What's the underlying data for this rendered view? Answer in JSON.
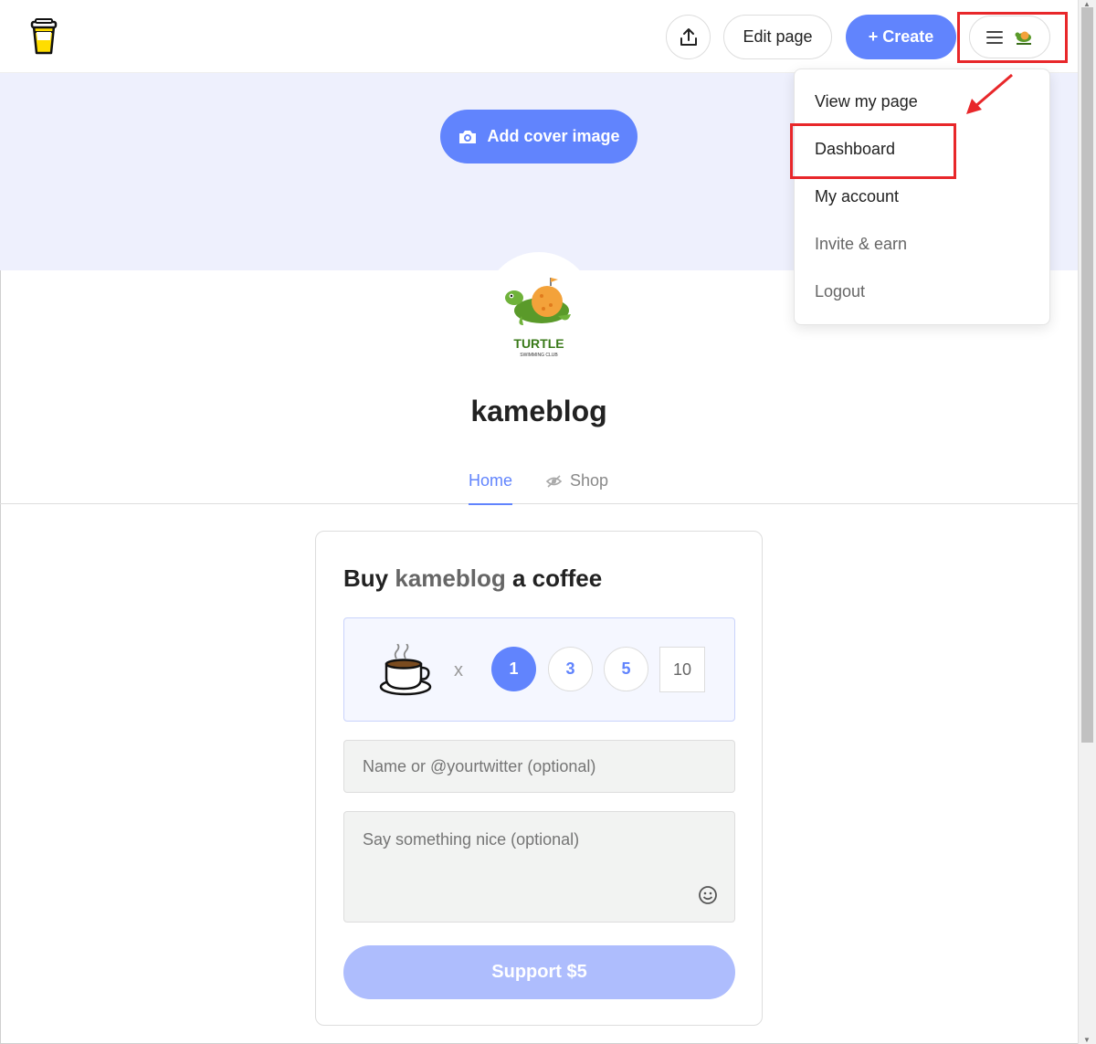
{
  "header": {
    "edit_label": "Edit page",
    "create_label": "+ Create"
  },
  "cover": {
    "add_cover_label": "Add cover image"
  },
  "profile": {
    "username": "kameblog",
    "avatar_title": "TURTLE",
    "avatar_subtitle": "SWIMMING CLUB"
  },
  "tabs": [
    {
      "label": "Home",
      "active": true
    },
    {
      "label": "Shop",
      "active": false
    }
  ],
  "support": {
    "title_prefix": "Buy",
    "title_name": "kameblog",
    "title_suffix": "a coffee",
    "times": "x",
    "quantities": [
      "1",
      "3",
      "5"
    ],
    "custom_quantity": "10",
    "name_placeholder": "Name or @yourtwitter (optional)",
    "message_placeholder": "Say something nice (optional)",
    "button_label": "Support $5"
  },
  "dropdown": {
    "items": [
      "View my page",
      "Dashboard",
      "My account",
      "Invite & earn",
      "Logout"
    ]
  },
  "colors": {
    "accent": "#6184fd",
    "cover_bg": "#eef0fd",
    "highlight": "#e8272a"
  }
}
